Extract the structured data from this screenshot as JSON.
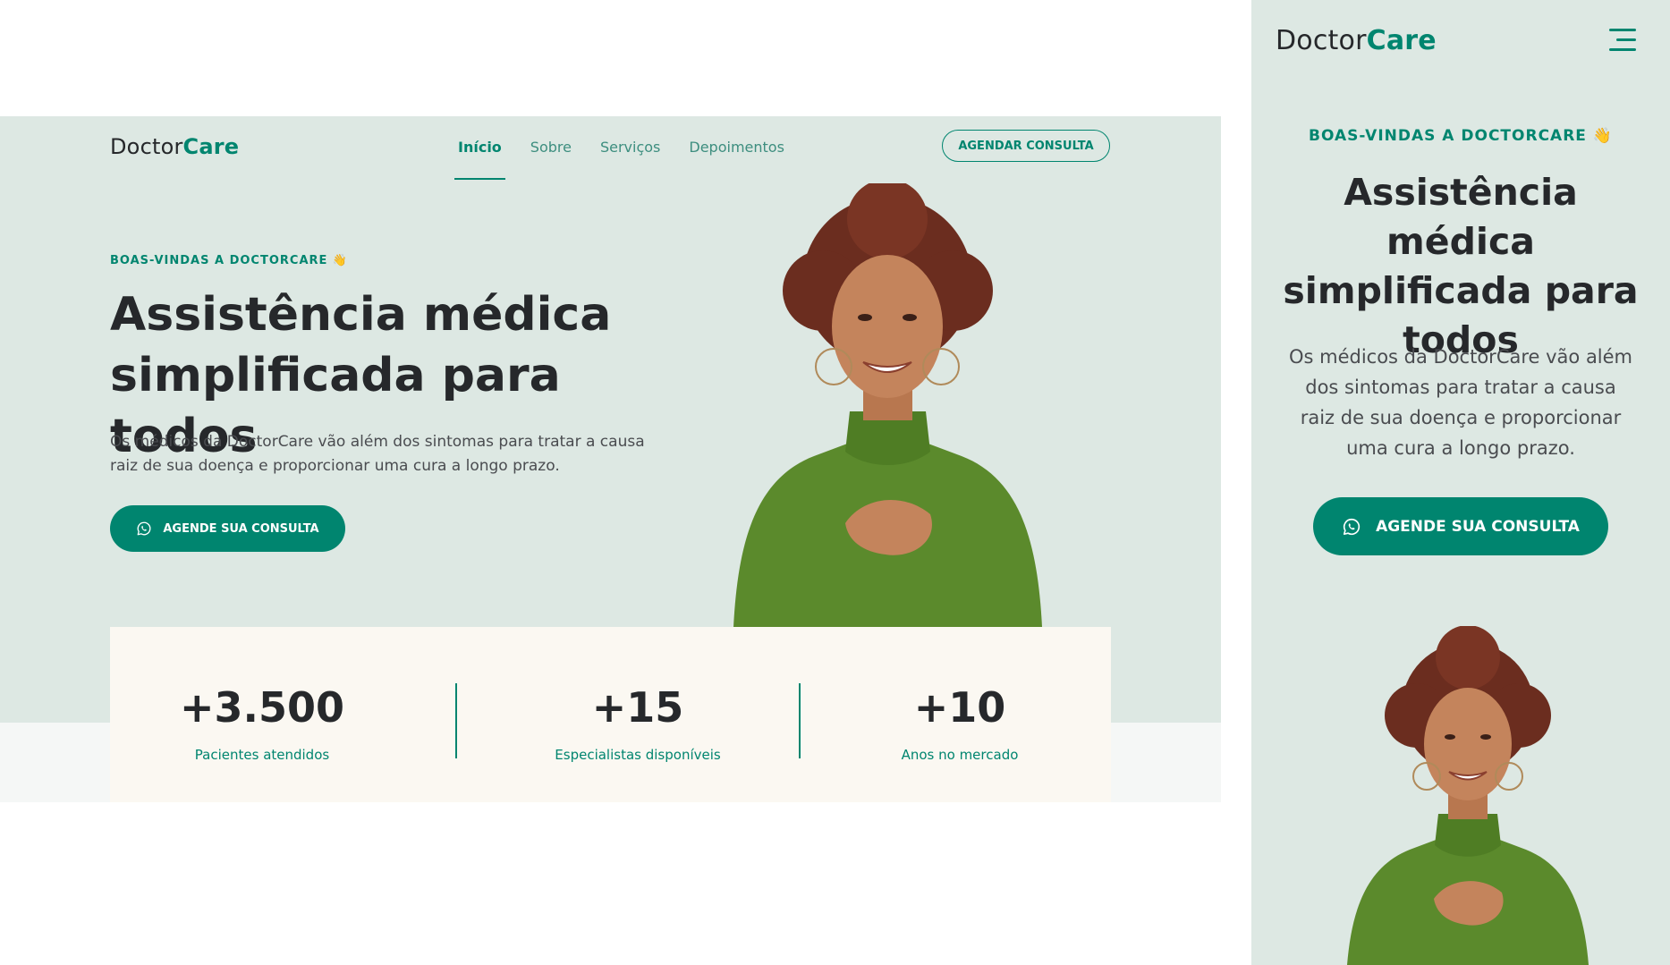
{
  "brand": {
    "name_part1": "Doctor",
    "name_part2": "Care"
  },
  "nav": {
    "items": [
      "Início",
      "Sobre",
      "Serviços",
      "Depoimentos"
    ],
    "active": 0,
    "cta_label": "AGENDAR CONSULTA"
  },
  "hero": {
    "tagline": "BOAS-VINDAS A DOCTORCARE 👋",
    "title": "Assistência médica simplificada para todos",
    "description": "Os médicos da DoctorCare vão além dos sintomas para tratar a causa raiz de sua doença e proporcionar uma cura a longo prazo.",
    "cta_label": "AGENDE SUA CONSULTA"
  },
  "stats": [
    {
      "value": "+3.500",
      "label": "Pacientes atendidos"
    },
    {
      "value": "+15",
      "label": "Especialistas disponíveis"
    },
    {
      "value": "+10",
      "label": "Anos no mercado"
    }
  ],
  "icons": {
    "cta_icon": "whatsapp-icon",
    "mobile_menu_icon": "hamburger-menu-icon"
  },
  "colors": {
    "brand_green": "#00856f",
    "hero_background": "#dde8e3",
    "stats_background": "#fbf8f2",
    "text_dark": "#26282b"
  }
}
